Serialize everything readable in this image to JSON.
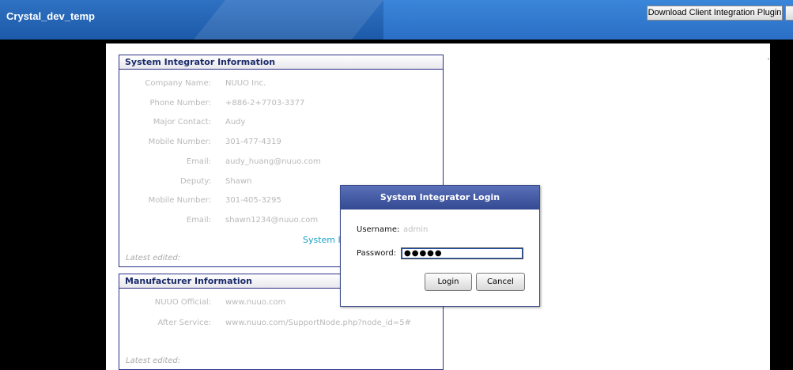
{
  "header": {
    "app_title": "Crystal_dev_temp",
    "plugin_button": "Download Client Integration Plugin"
  },
  "system_integrator": {
    "title": "System Integrator Information",
    "rows": [
      {
        "label": "Company Name:",
        "value": "NUUO Inc."
      },
      {
        "label": "Phone Number:",
        "value": "+886-2+7703-3377"
      },
      {
        "label": "Major Contact:",
        "value": "Audy"
      },
      {
        "label": "Mobile Number:",
        "value": "301-477-4319"
      },
      {
        "label": "Email:",
        "value": "audy_huang@nuuo.com"
      },
      {
        "label": "Deputy:",
        "value": "Shawn"
      },
      {
        "label": "Mobile Number:",
        "value": "301-405-3295"
      },
      {
        "label": "Email:",
        "value": "shawn1234@nuuo.com"
      }
    ],
    "link_partial": "System In",
    "latest_edited": "Latest edited:"
  },
  "manufacturer": {
    "title": "Manufacturer Information",
    "rows": [
      {
        "label": "NUUO Official:",
        "value": "www.nuuo.com"
      },
      {
        "label": "After Service:",
        "value": "www.nuuo.com/SupportNode.php?node_id=5#"
      }
    ],
    "latest_edited": "Latest edited:"
  },
  "login_dialog": {
    "title": "System Integrator Login",
    "username_label": "Username:",
    "username_value": "admin",
    "password_label": "Password:",
    "password_masked": "●●●●●",
    "login_button": "Login",
    "cancel_button": "Cancel"
  }
}
